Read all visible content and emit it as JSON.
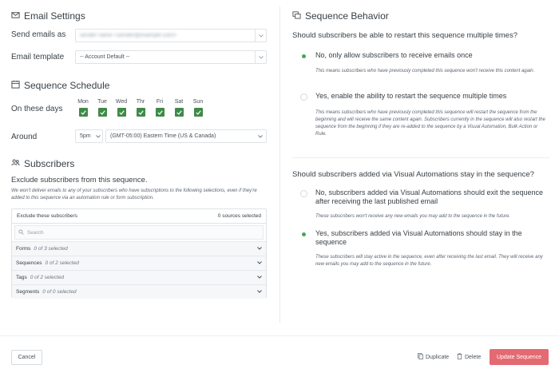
{
  "email_settings": {
    "title": "Email Settings",
    "send_as_label": "Send emails as",
    "send_as_value": "sender name <sender@example.com>",
    "template_label": "Email template",
    "template_value": "-- Account Default --"
  },
  "schedule": {
    "title": "Sequence Schedule",
    "days_label": "On these days",
    "days": [
      "Mon",
      "Tue",
      "Wed",
      "Thr",
      "Fri",
      "Sat",
      "Sun"
    ],
    "around_label": "Around",
    "time_value": "5pm",
    "timezone_value": "(GMT-05:00) Eastern Time (US & Canada)"
  },
  "subscribers": {
    "title": "Subscribers",
    "exclude_heading": "Exclude subscribers from this sequence.",
    "exclude_help": "We won't deliver emails to any of your subscribers who have subscriptions to the following selections, even if they're added to this sequence via an automation rule or form subscription.",
    "box_label": "Exclude these subscribers",
    "sources_selected": "0 sources selected",
    "search_placeholder": "Search",
    "rows": [
      {
        "name": "Forms",
        "count": "0 of 3 selected"
      },
      {
        "name": "Sequences",
        "count": "0 of 2 selected"
      },
      {
        "name": "Tags",
        "count": "0 of 2 selected"
      },
      {
        "name": "Segments",
        "count": "0 of 0 selected"
      }
    ]
  },
  "behavior": {
    "title": "Sequence Behavior",
    "q1": "Should subscribers be able to restart this sequence multiple times?",
    "q1_opt1": "No, only allow subscribers to receive emails once",
    "q1_opt1_help": "This means subscribers who have previously completed this sequence won't receive this content again.",
    "q1_opt2": "Yes, enable the ability to restart the sequence multiple times",
    "q1_opt2_help": "This means subscribers who have previously completed this sequence will restart the sequence from the beginning and will receive the same content again. Subscribers currently in the sequence will also restart the sequence from the beginning if they are re-added to the sequence by a Visual Automation, Bulk Action or Rule.",
    "q2": "Should subscribers added via Visual Automations stay in the sequence?",
    "q2_opt1": "No, subscribers added via Visual Automations should exit the sequence after receiving the last published email",
    "q2_opt1_help": "These subscribers won't receive any new emails you may add to the sequence in the future.",
    "q2_opt2": "Yes, subscribers added via Visual Automations should stay in the sequence",
    "q2_opt2_help": "These subscribers will stay active in the sequence, even after receiving the last email. They will receive any new emails you may add to the sequence in the future."
  },
  "footer": {
    "cancel": "Cancel",
    "duplicate": "Duplicate",
    "delete": "Delete",
    "update": "Update Sequence"
  },
  "colors": {
    "accent_green": "#47a65a",
    "checkbox_green": "#3f8a49",
    "update_button": "#e46a72"
  }
}
